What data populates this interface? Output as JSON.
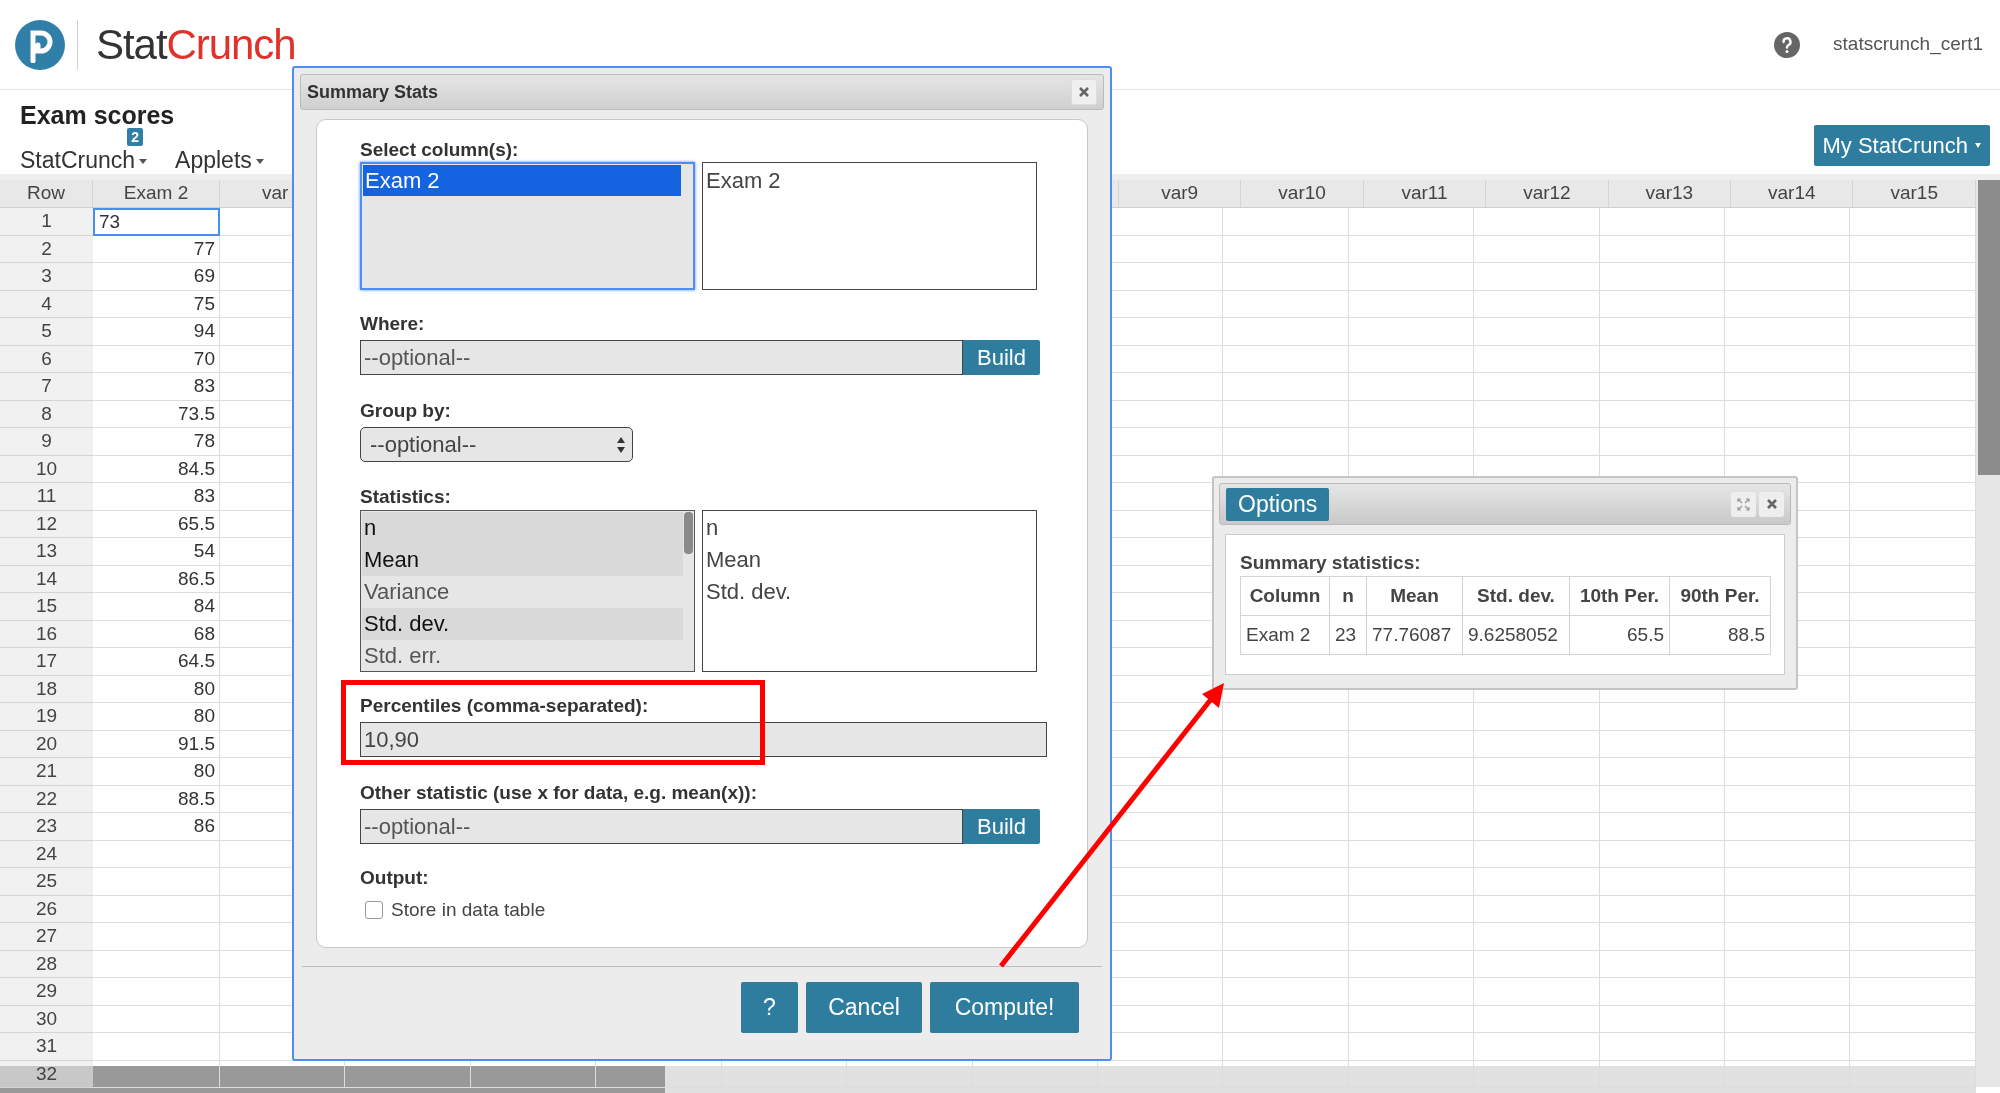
{
  "header": {
    "brand": [
      "Stat",
      "Crunch"
    ],
    "username": "statscrunch_cert1"
  },
  "data_title": "Exam scores",
  "menus": [
    {
      "label": "StatCrunch",
      "badge": "2"
    },
    {
      "label": "Applets"
    }
  ],
  "account_button": "My StatCrunch",
  "grid": {
    "columns_left": [
      "Row",
      "Exam 2",
      "var"
    ],
    "columns_right": [
      "var9",
      "var10",
      "var11",
      "var12",
      "var13",
      "var14",
      "var15"
    ],
    "rows": [
      {
        "row": "1",
        "value": "73",
        "selected": true
      },
      {
        "row": "2",
        "value": "77",
        "selected": false
      },
      {
        "row": "3",
        "value": "69",
        "selected": false
      },
      {
        "row": "4",
        "value": "75",
        "selected": false
      },
      {
        "row": "5",
        "value": "94",
        "selected": false
      },
      {
        "row": "6",
        "value": "70",
        "selected": false
      },
      {
        "row": "7",
        "value": "83",
        "selected": false
      },
      {
        "row": "8",
        "value": "73.5",
        "selected": false
      },
      {
        "row": "9",
        "value": "78",
        "selected": false
      },
      {
        "row": "10",
        "value": "84.5",
        "selected": false
      },
      {
        "row": "11",
        "value": "83",
        "selected": false
      },
      {
        "row": "12",
        "value": "65.5",
        "selected": false
      },
      {
        "row": "13",
        "value": "54",
        "selected": false
      },
      {
        "row": "14",
        "value": "86.5",
        "selected": false
      },
      {
        "row": "15",
        "value": "84",
        "selected": false
      },
      {
        "row": "16",
        "value": "68",
        "selected": false
      },
      {
        "row": "17",
        "value": "64.5",
        "selected": false
      },
      {
        "row": "18",
        "value": "80",
        "selected": false
      },
      {
        "row": "19",
        "value": "80",
        "selected": false
      },
      {
        "row": "20",
        "value": "91.5",
        "selected": false
      },
      {
        "row": "21",
        "value": "80",
        "selected": false
      },
      {
        "row": "22",
        "value": "88.5",
        "selected": false
      },
      {
        "row": "23",
        "value": "86",
        "selected": false
      },
      {
        "row": "24",
        "selected": false
      },
      {
        "row": "25",
        "selected": false
      },
      {
        "row": "26",
        "selected": false
      },
      {
        "row": "27",
        "selected": false
      },
      {
        "row": "28",
        "selected": false
      },
      {
        "row": "29",
        "selected": false
      },
      {
        "row": "30",
        "selected": false
      },
      {
        "row": "31",
        "selected": false
      },
      {
        "row": "32",
        "selected": false
      }
    ]
  },
  "dialog": {
    "title": "Summary Stats",
    "select_label": "Select column(s):",
    "column_options": [
      {
        "label": "Exam 2",
        "selected": true
      }
    ],
    "chosen_columns": [
      "Exam 2"
    ],
    "where": {
      "label": "Where:",
      "placeholder": "--optional--",
      "button": "Build"
    },
    "group_by": {
      "label": "Group by:",
      "value": "--optional--"
    },
    "statistics": {
      "label": "Statistics:",
      "options": [
        {
          "label": "n",
          "selected": true
        },
        {
          "label": "Mean",
          "selected": true
        },
        {
          "label": "Variance",
          "selected": false
        },
        {
          "label": "Std. dev.",
          "selected": true
        },
        {
          "label": "Std. err.",
          "selected": false
        }
      ],
      "chosen": [
        "n",
        "Mean",
        "Std. dev."
      ]
    },
    "percentiles": {
      "label": "Percentiles (comma-separated):",
      "value": "10,90",
      "highlighted": true
    },
    "other_statistic": {
      "label": "Other statistic (use x for data, e.g. mean(x)):",
      "placeholder": "--optional--",
      "button": "Build"
    },
    "output": {
      "label": "Output:",
      "option": "Store in data table",
      "checked": false
    },
    "buttons": [
      "?",
      "Cancel",
      "Compute!"
    ]
  },
  "callout_arrow": true,
  "options_window": {
    "title": "Options",
    "heading": "Summary statistics:",
    "columns": [
      "Column",
      "n",
      "Mean",
      "Std. dev.",
      "10th Per.",
      "90th Per."
    ],
    "rows": [
      [
        "Exam 2",
        "23",
        "77.76087",
        "9.6258052",
        "65.5",
        "88.5"
      ]
    ]
  }
}
